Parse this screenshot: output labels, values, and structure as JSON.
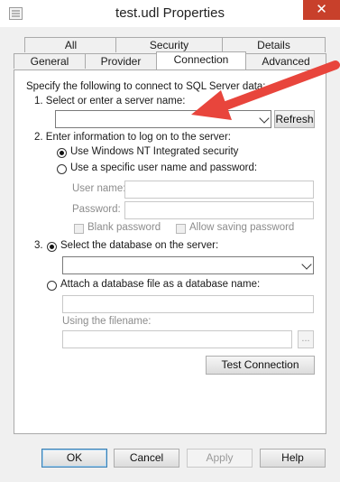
{
  "window": {
    "title": "test.udl Properties",
    "close_glyph": "✕",
    "app_icon": "document-icon"
  },
  "tabs": {
    "row1": [
      "All",
      "Security",
      "Details"
    ],
    "row2": [
      "General",
      "Provider",
      "Connection",
      "Advanced"
    ],
    "active": "Connection"
  },
  "connection": {
    "intro": "Specify the following to connect to SQL Server data:",
    "step1_label": "1. Select or enter a server name:",
    "server_name_value": "",
    "refresh_label": "Refresh",
    "step2_label": "2. Enter information to log on to the server:",
    "windows_security_label": "Use Windows NT Integrated security",
    "specific_user_label": "Use a specific user name and password:",
    "username_label": "User name:",
    "username_value": "",
    "password_label": "Password:",
    "password_value": "",
    "blank_password_label": "Blank password",
    "allow_saving_label": "Allow saving password",
    "step3_number": "3.",
    "select_db_label": "Select the database on the server:",
    "database_value": "",
    "attach_db_label": "Attach a database file as a database name:",
    "attach_db_value": "",
    "filename_label": "Using the filename:",
    "filename_value": "",
    "browse_label": "...",
    "test_connection_label": "Test Connection",
    "logon_mode": "windows",
    "database_mode": "select"
  },
  "footer": {
    "ok_label": "OK",
    "cancel_label": "Cancel",
    "apply_label": "Apply",
    "help_label": "Help"
  },
  "annotation": {
    "arrow_color": "#e8453c",
    "arrow_icon": "red-arrow-annotation"
  }
}
